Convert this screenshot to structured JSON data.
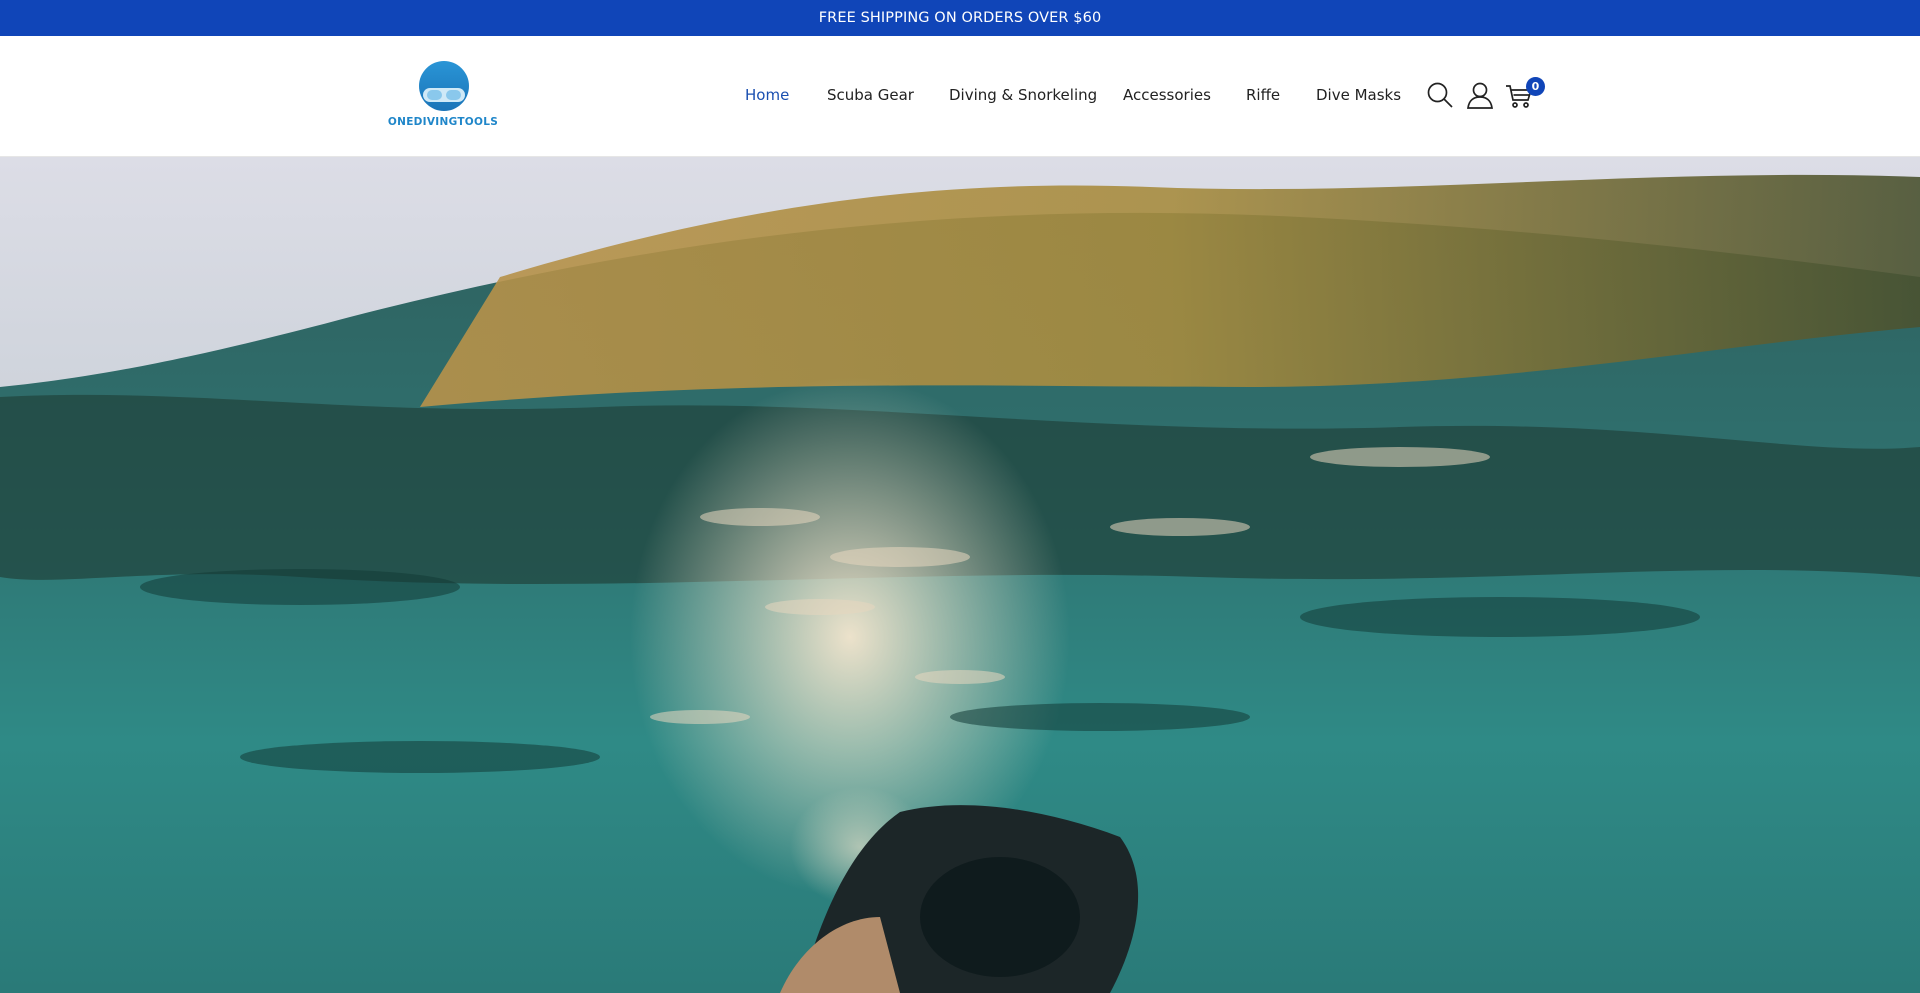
{
  "announcement": {
    "text": "FREE SHIPPING ON ORDERS OVER $60"
  },
  "brand": {
    "name": "ONEDIVINGTOOLS",
    "primary_color": "#1045b8",
    "logo_color": "#1f86c9"
  },
  "nav": {
    "items": [
      {
        "label": "Home",
        "active": true
      },
      {
        "label": "Scuba Gear",
        "active": false
      },
      {
        "label": "Diving & Snorkeling",
        "active": false
      },
      {
        "label": "Accessories",
        "active": false
      },
      {
        "label": "Riffe",
        "active": false
      },
      {
        "label": "Dive Masks",
        "active": false
      }
    ]
  },
  "header_icons": {
    "search": "search-icon",
    "account": "user-icon",
    "cart": "cart-icon",
    "cart_count": "0"
  },
  "hero": {
    "image": "underwater snorkeler split-level photo"
  }
}
